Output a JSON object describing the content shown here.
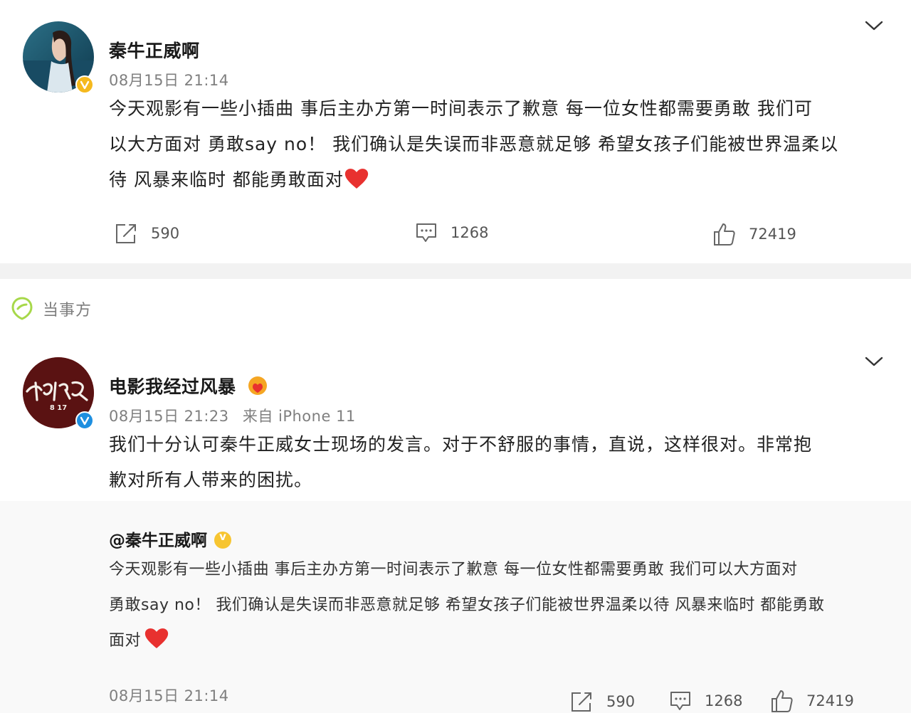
{
  "post1": {
    "author": "秦牛正威啊",
    "timestamp": "08月15日 21:14",
    "text_line1": "今天观影有一些小插曲 事后主办方第一时间表示了歉意 每一位女性都需要勇敢 我们可",
    "text_line2": "以大方面对 勇敢say no！ 我们确认是失误而非恶意就足够 希望女孩子们能被世界温柔以",
    "text_line3": "待 风暴来临时 都能勇敢面对",
    "repost_count": "590",
    "comment_count": "1268",
    "like_count": "72419",
    "badge_color": "#f5b91e"
  },
  "section": {
    "label": "当事方",
    "icon": "location-pin-icon",
    "icon_color": "#a7d84a"
  },
  "post2": {
    "author": "电影我经过风暴",
    "timestamp": "08月15日 21:23",
    "source": "来自 iPhone 11",
    "text_line1": "我们十分认可秦牛正威女士现场的发言。对于不舒服的事情，直说，这样很对。非常抱",
    "text_line2": "歉对所有人带来的困扰。",
    "badge_color": "#1e8fe0",
    "quoted": {
      "author": "@秦牛正威啊",
      "text_line1": "今天观影有一些小插曲 事后主办方第一时间表示了歉意 每一位女性都需要勇敢 我们可以大方面对",
      "text_line2": "勇敢say no！ 我们确认是失误而非恶意就足够 希望女孩子们能被世界温柔以待 风暴来临时 都能勇敢",
      "text_line3": "面对",
      "timestamp": "08月15日 21:14",
      "repost_count": "590",
      "comment_count": "1268",
      "like_count": "72419"
    }
  },
  "colors": {
    "heart": "#e8312f",
    "separator": "#f2f2f2",
    "quote_bg": "#f9f9f9"
  }
}
